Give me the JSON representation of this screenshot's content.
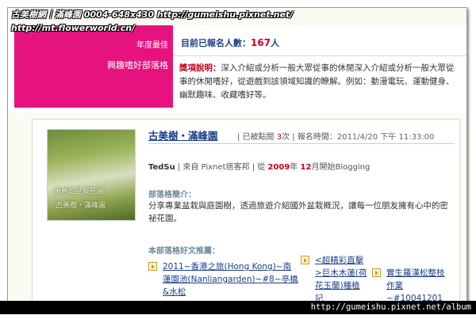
{
  "watermark": {
    "line1": "古美樹網｜滿峰園 0004-648x430 http://gumeishu.pixnet.net/",
    "line2": "http://mt.flowerworld.cn/",
    "bottom": "http://gumeishu.pixnet.net/album"
  },
  "award": {
    "label_top": "年度最佳",
    "label_category": "興趣嗜好部落格",
    "count_label": "目前已報名人數：",
    "count_value": "167",
    "count_unit": "人",
    "desc_label": "獎項說明：",
    "desc_text": "深入介紹或分析一般大眾從事的休閒深入介紹或分析一般大眾從事的休閒嗜好，從遊戲到該領域知識的瞭解。例如：動漫電玩、運動健身、幽默趣味、收藏嗜好等。"
  },
  "card": {
    "title": "古美樹・滿峰園",
    "hits_prefix": "| 已被點閱 ",
    "hits_value": "3",
    "hits_suffix": "次 | 報名時間：",
    "timestamp": "2011/4/20 下午 11:33:00",
    "thumb_caption1": "美麗的盆栽花園",
    "thumb_caption2": "古美樹・滿峰園",
    "user_name": "TedSu",
    "user_from": " | 來自 Pixnet痞客邦 | 從 ",
    "start_year": "2009",
    "year_unit": "年 ",
    "start_month": "12",
    "month_suffix": "月開始Blogging",
    "intro_heading": "部落格簡介：",
    "intro_text": "分享專業盆栽與庭園樹，透過旅遊介紹國外盆栽概況，讓每一位朋友擁有心中的密祕花園。",
    "posts_heading": "本部落格好文推薦：",
    "posts": [
      "2011~香港之旅(Hong Kong)~南蓮園池(Nanliangarden)~#8~亭橋&水松",
      "<超精彩直擊>巨木木蓮(荷花玉蘭)種植記",
      "實生羅漢松整枝作業~#10041201"
    ]
  }
}
